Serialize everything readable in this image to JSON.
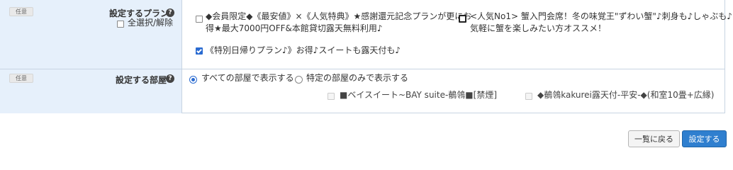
{
  "plan_row": {
    "badge": "任意",
    "label": "設定するプラン",
    "help_glyph": "?",
    "select_all_label": "全選択/解除",
    "plans": [
      {
        "line1": "◆会員限定◆《最安値》×《人気特典》★感謝還元記念プランが更にお",
        "line2": "得★最大7000円OFF&本館貸切露天無料利用♪",
        "checked": false
      },
      {
        "line1": "<人気No1> 蟹入門会席！冬の味覚王\"ずわい蟹\"♪刺身も♪しゃぶも♪",
        "line2": "気軽に蟹を楽しみたい方オススメ！",
        "checked": false
      },
      {
        "line1": "《特別日帰りプラン♪》お得♪スイートも露天付も♪",
        "checked": true
      }
    ]
  },
  "room_row": {
    "badge": "任意",
    "label": "設定する部屋",
    "help_glyph": "?",
    "options": [
      {
        "label": "すべての部屋で表示する",
        "selected": true
      },
      {
        "label": "特定の部屋のみで表示する",
        "selected": false
      }
    ],
    "rooms": [
      {
        "label": "■ベイスイート~BAY suite-鶺鴒■[禁煙]"
      },
      {
        "label": "◆鶺鴒kakurei露天付-平安-◆(和室10畳+広縁)"
      }
    ]
  },
  "footer": {
    "back_label": "一覧に戻る",
    "submit_label": "設定する"
  },
  "colors": {
    "label_bg": "#e6f0fb",
    "border": "#c8d4e2",
    "accent": "#2f7fcf"
  }
}
